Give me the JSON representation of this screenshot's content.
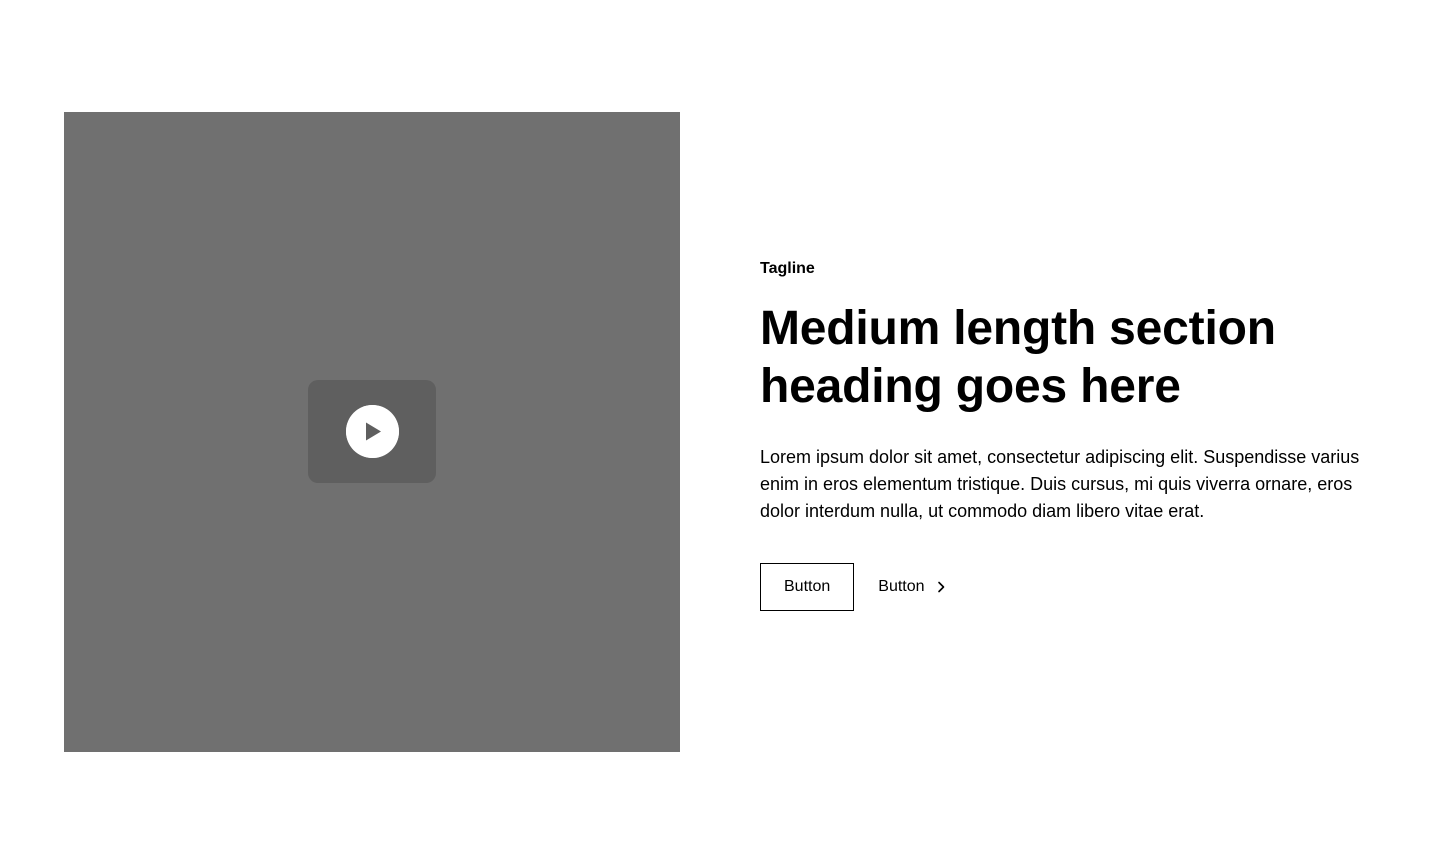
{
  "media": {
    "background_color": "#707070",
    "play_button_color": "#5f5f5f",
    "icon": "play-icon"
  },
  "content": {
    "tagline": "Tagline",
    "heading": "Medium length section heading goes here",
    "body": "Lorem ipsum dolor sit amet, consectetur adipiscing elit. Suspendisse varius enim in eros elementum tristique. Duis cursus, mi quis viverra ornare, eros dolor interdum nulla, ut commodo diam libero vitae erat."
  },
  "actions": {
    "primary_label": "Button",
    "secondary_label": "Button",
    "secondary_icon": "chevron-right-icon"
  }
}
